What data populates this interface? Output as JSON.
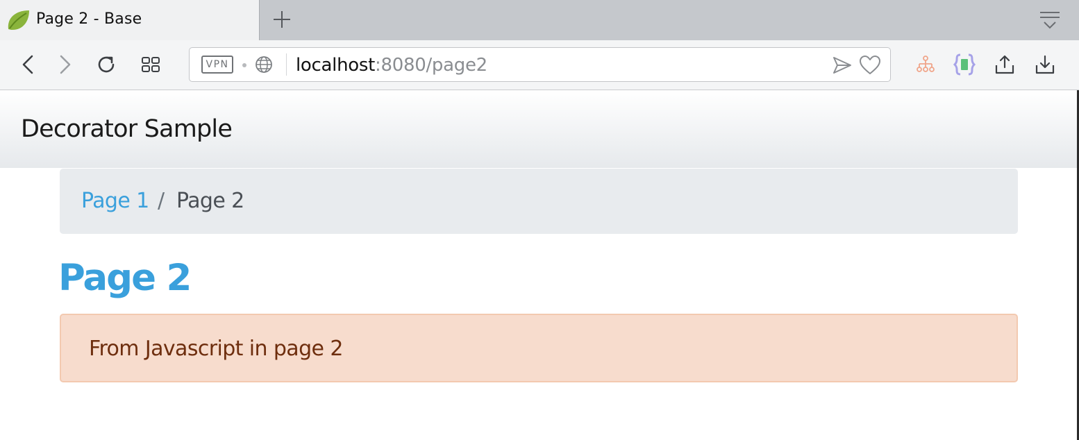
{
  "browser": {
    "tab": {
      "title": "Page 2 - Base",
      "favicon": "spring-leaf-icon"
    },
    "toolbar": {
      "url_host": "localhost",
      "url_rest": ":8080/page2",
      "vpn_label": "VPN",
      "icons": [
        "back-arrow-icon",
        "forward-arrow-icon",
        "reload-icon",
        "speed-dial-icon",
        "globe-icon",
        "send-icon",
        "heart-icon",
        "sitemap-icon",
        "braces-icon",
        "share-icon",
        "download-icon",
        "tab-menu-icon"
      ]
    },
    "colors": {
      "tabstrip": "#c5c8cc",
      "active_tab": "#f0f1f2",
      "toolbar": "#f4f5f6"
    }
  },
  "page": {
    "navbar": {
      "brand": "Decorator Sample"
    },
    "breadcrumb": {
      "link": "Page 1",
      "separator": "/",
      "current": "Page 2"
    },
    "title": "Page 2",
    "alert": {
      "text": "From Javascript in page 2"
    },
    "colors": {
      "accent": "#3aa0dc",
      "alert_bg": "#f7dccd",
      "alert_text": "#6e2e0e",
      "breadcrumb_bg": "#e8ebee"
    }
  }
}
